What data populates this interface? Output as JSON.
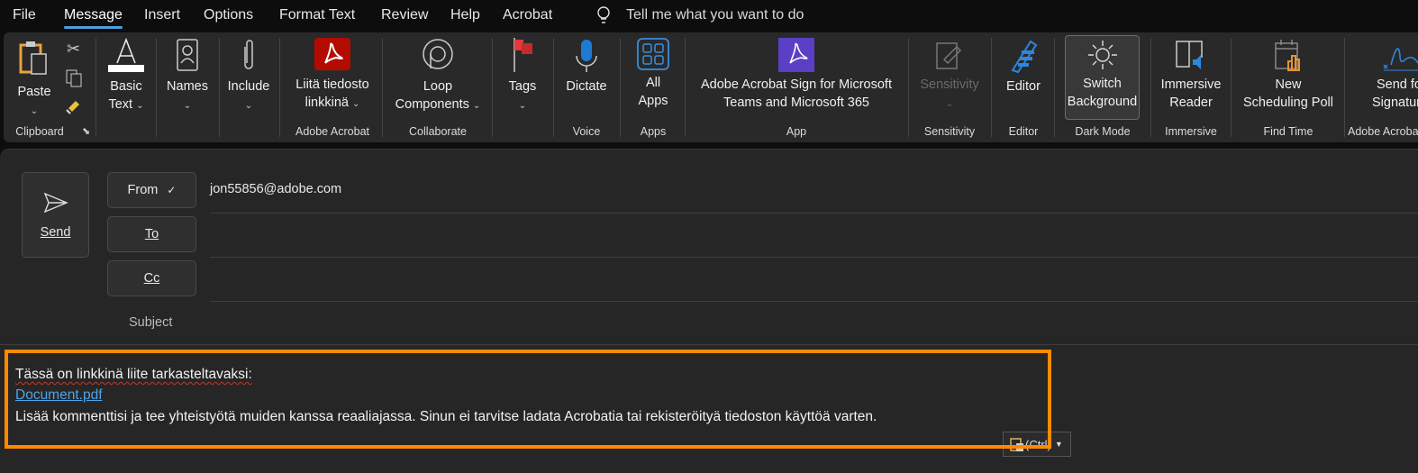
{
  "menu": {
    "tabs": [
      "File",
      "Message",
      "Insert",
      "Options",
      "Format Text",
      "Review",
      "Help",
      "Acrobat"
    ],
    "active": "Message",
    "search_placeholder": "Tell me what you want to do"
  },
  "ribbon": {
    "paste": "Paste",
    "groups": {
      "clipboard": "Clipboard",
      "adobe_acrobat": "Adobe Acrobat",
      "collaborate": "Collaborate",
      "voice": "Voice",
      "apps": "Apps",
      "app": "App",
      "sensitivity": "Sensitivity",
      "editor": "Editor",
      "dark_mode": "Dark Mode",
      "immersive": "Immersive",
      "find_time": "Find Time",
      "adobe_acrobat_2": "Adobe Acrobat"
    },
    "basic_text": [
      "Basic",
      "Text"
    ],
    "names": "Names",
    "include": "Include",
    "liita": [
      "Liitä tiedosto",
      "linkkinä"
    ],
    "loop": [
      "Loop",
      "Components"
    ],
    "tags": "Tags",
    "dictate": "Dictate",
    "all_apps": [
      "All",
      "Apps"
    ],
    "acrobat_sign": [
      "Adobe Acrobat Sign for Microsoft",
      "Teams and Microsoft 365"
    ],
    "sensitivity": "Sensitivity",
    "editor": "Editor",
    "switch_bg": [
      "Switch",
      "Background"
    ],
    "immersive_reader": [
      "Immersive",
      "Reader"
    ],
    "scheduling_poll": [
      "New",
      "Scheduling Poll"
    ],
    "send_signature": [
      "Send for",
      "Signature"
    ]
  },
  "compose": {
    "send": "Send",
    "from": "From",
    "to": "To",
    "cc": "Cc",
    "subject": "Subject",
    "from_value": "jon55856@adobe.com"
  },
  "body": {
    "line1": "Tässä on linkkinä liite tarkasteltavaksi:",
    "link": "Document.pdf",
    "line3": "Lisää kommenttisi ja tee yhteistyötä muiden kanssa reaaliajassa. Sinun ei tarvitse ladata Acrobatia tai rekisteröityä tiedoston käyttöä varten.",
    "paste_options": "(Ctrl)"
  },
  "colors": {
    "accent": "#4ca0e0",
    "highlight": "#ff8a00",
    "link": "#4da3e8"
  }
}
